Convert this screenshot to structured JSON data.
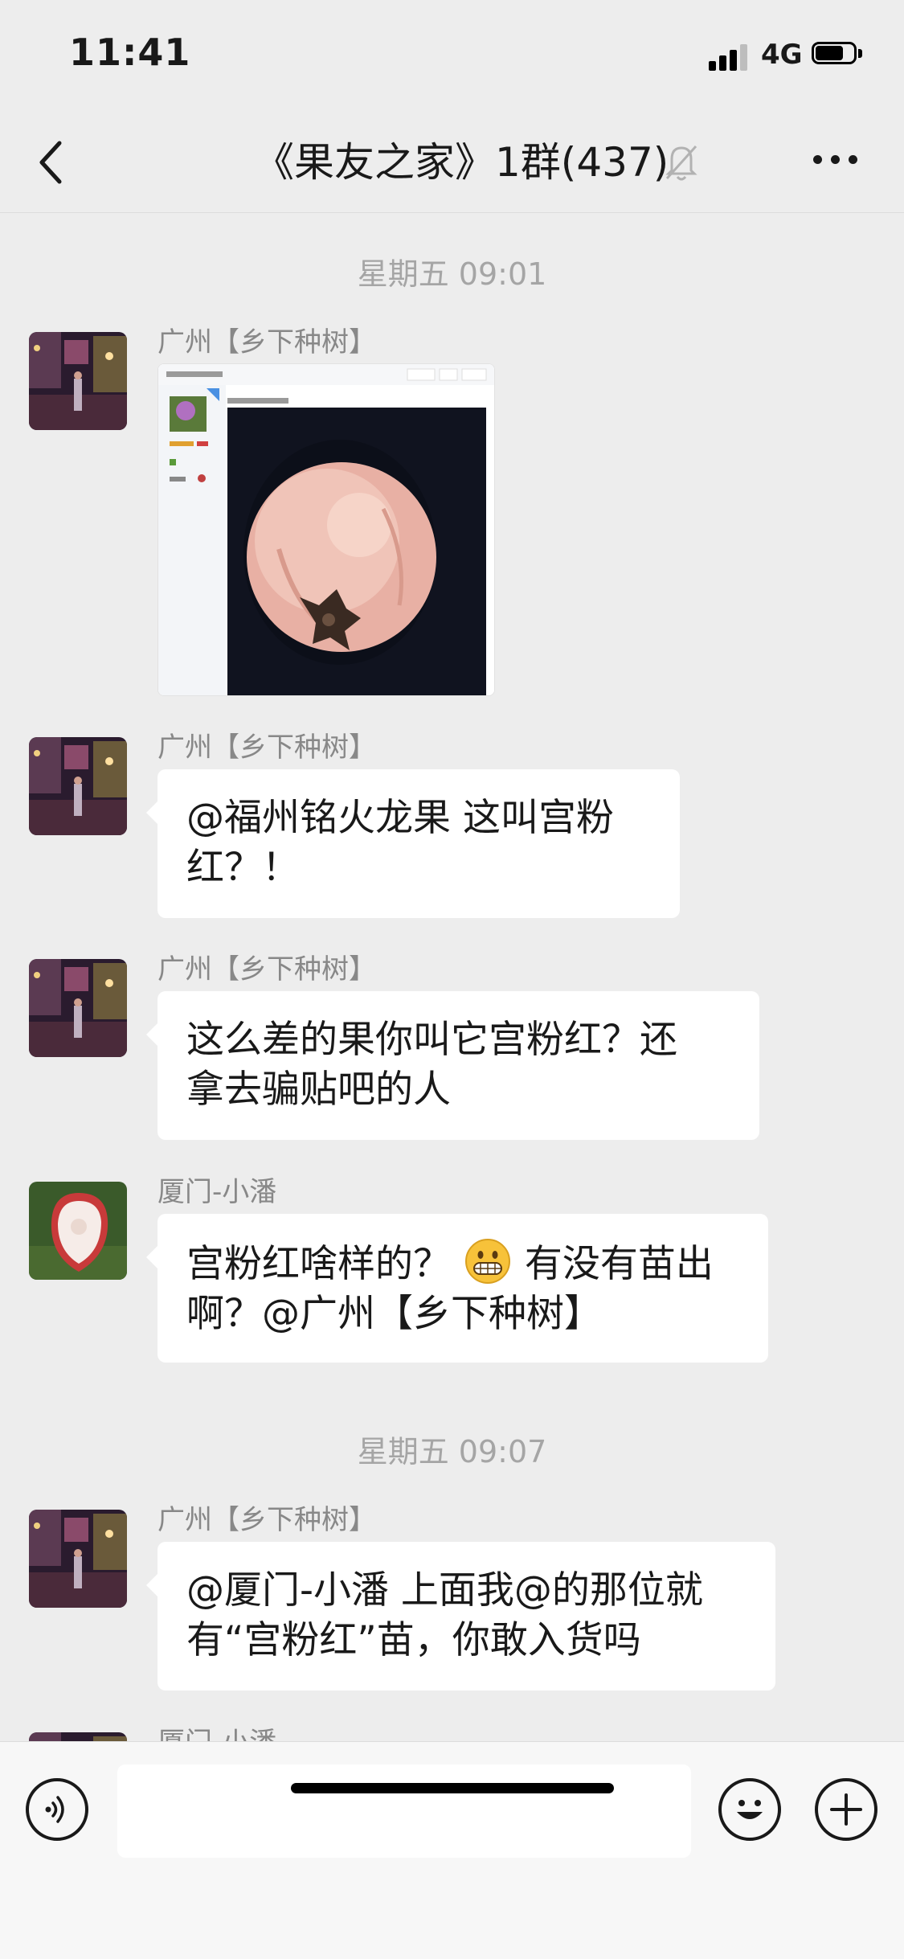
{
  "status_bar": {
    "time": "11:41",
    "network": "4G"
  },
  "nav": {
    "title": "《果友之家》1群(437)"
  },
  "messages": {
    "ts1": "星期五 09:01",
    "m1_sender": "广州【乡下种树】",
    "m2_sender": "广州【乡下种树】",
    "m2_line1": "@福州铭火龙果 这叫宫粉",
    "m2_line2": "红？！",
    "m3_sender": "广州【乡下种树】",
    "m3_line1": "这么差的果你叫它宫粉红？还",
    "m3_line2": "拿去骗贴吧的人",
    "m4_sender": "厦门-小潘",
    "m4_line1_a": "宫粉红啥样的？",
    "m4_line1_b": "有没有苗出",
    "m4_line2": "啊？@广州【乡下种树】",
    "ts2": "星期五 09:07",
    "m5_sender": "广州【乡下种树】",
    "m5_line1": "@厦门-小潘 上面我@的那位就",
    "m5_line2": "有“宫粉红”苗，你敢入货吗",
    "m6_sender": "厦门-小潘"
  },
  "input": {
    "placeholder": ""
  },
  "icons": {
    "back": "chevron-left-icon",
    "mute": "bell-off-icon",
    "more": "more-dots-icon",
    "voice": "voice-icon",
    "emoji": "emoji-icon",
    "plus": "plus-icon"
  },
  "colors": {
    "background": "#ededed",
    "bubble": "#ffffff",
    "timestamp": "#a5a5a5",
    "sender": "#888888"
  }
}
